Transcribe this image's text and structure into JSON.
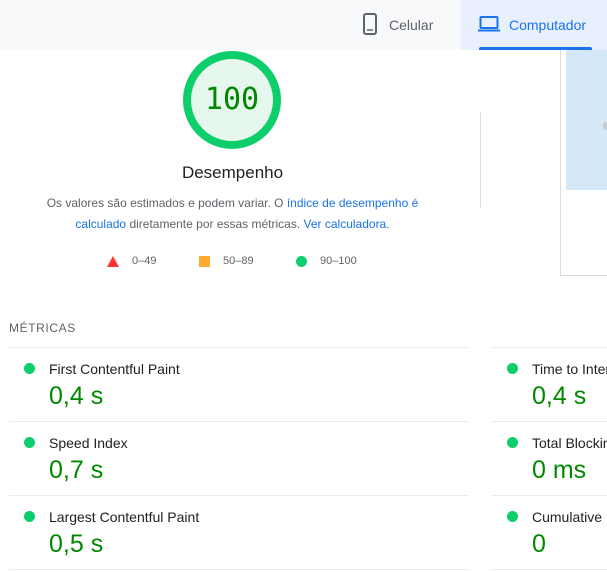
{
  "tabs": [
    {
      "label": "Celular",
      "icon": "phone-icon",
      "active": false
    },
    {
      "label": "Computador",
      "icon": "laptop-icon",
      "active": true
    }
  ],
  "score": {
    "value": "100",
    "fraction": 1.0,
    "color": "#0cce6b",
    "text_color": "#008800",
    "fill": "#e6f8ee"
  },
  "category_title": "Desempenho",
  "description": {
    "text1": "Os valores são estimados e podem variar. O ",
    "link1": "índice de desempenho é calculado",
    "text2": " diretamente por essas métricas. ",
    "link2": "Ver calculadora",
    "text3": "."
  },
  "legend": [
    {
      "label": "0–49",
      "shape": "triangle",
      "color": "#ff3333"
    },
    {
      "label": "50–89",
      "shape": "square",
      "color": "#ffaa33"
    },
    {
      "label": "90–100",
      "shape": "circle",
      "color": "#0cce6b"
    }
  ],
  "metrics_header": "MÉTRICAS",
  "metrics_left": [
    {
      "label": "First Contentful Paint",
      "value": "0,4 s"
    },
    {
      "label": "Speed Index",
      "value": "0,7 s"
    },
    {
      "label": "Largest Contentful Paint",
      "value": "0,5 s"
    }
  ],
  "metrics_right": [
    {
      "label": "Time to Interactive",
      "value": "0,4 s"
    },
    {
      "label": "Total Blocking Time",
      "value": "0 ms"
    },
    {
      "label": "Cumulative Layout Shift",
      "value": "0"
    }
  ]
}
